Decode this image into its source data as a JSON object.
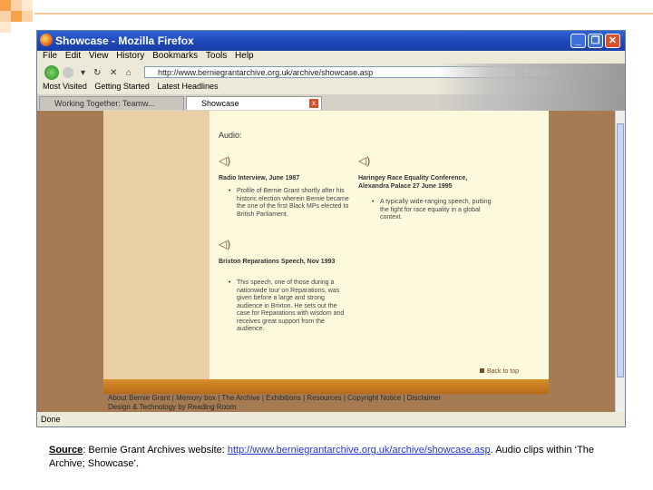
{
  "browser": {
    "window_title": "Showcase - Mozilla Firefox",
    "menu": [
      "File",
      "Edit",
      "View",
      "History",
      "Bookmarks",
      "Tools",
      "Help"
    ],
    "url": "http://www.berniegrantarchive.org.uk/archive/showcase.asp",
    "bookmarks": [
      "Most Visited",
      "Getting Started",
      "Latest Headlines"
    ],
    "tabs": [
      "Working Together: Teamw...",
      "Showcase"
    ],
    "status": "Done"
  },
  "content": {
    "heading": "Audio:",
    "items": [
      {
        "title": "Radio Interview, June 1987",
        "desc": "Profile of Bernie Grant shortly after his historic election wherein Bernie became the one of the first Black MPs elected to British Parliament."
      },
      {
        "title": "Haringey Race Equality Conference, Alexandra Palace 27 June 1995",
        "desc": "A typically wide-ranging speech, putting the fight for race equality in a global context."
      },
      {
        "title": "Brixton Reparations Speech, Nov 1993",
        "desc": "This speech, one of those during a nationwide tour on Reparations, was given before a large and strong audience in Brixton. He sets out the case for Reparations with wisdom and receives great support from the audience."
      }
    ],
    "back_to_top": "Back to top",
    "footer_line1": "About Bernie Grant | Memory box | The Archive | Exhibitions | Resources | Copyright Notice | Disclaimer",
    "footer_line2": "Design & Technology by Reading Room"
  },
  "caption": {
    "source_label": "Source",
    "text_before_link": ": Bernie Grant Archives website: ",
    "link": "http://www.berniegrantarchive.org.uk/archive/showcase.asp",
    "text_after_link": ". Audio clips within ‘The Archive; Showcase’."
  }
}
